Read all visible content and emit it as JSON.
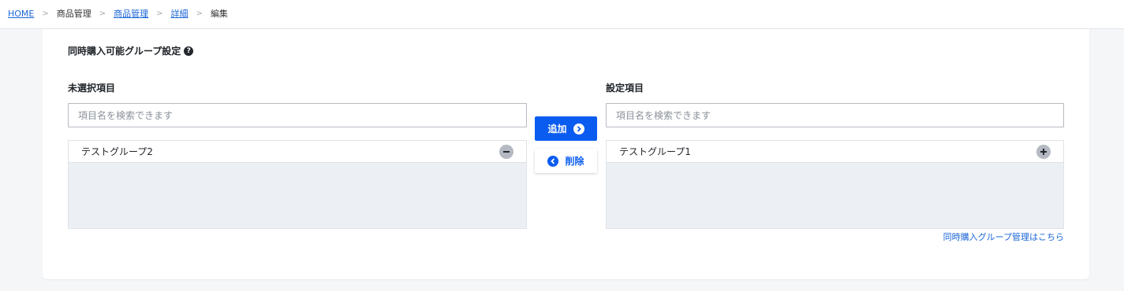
{
  "breadcrumb": {
    "items": [
      {
        "label": "HOME",
        "link": true
      },
      {
        "label": "商品管理",
        "link": false
      },
      {
        "label": "商品管理",
        "link": true
      },
      {
        "label": "詳細",
        "link": true
      },
      {
        "label": "編集",
        "link": false
      }
    ],
    "separator": ">"
  },
  "section": {
    "title": "同時購入可能グループ設定",
    "help_icon": "question-circle-icon"
  },
  "left_panel": {
    "label": "未選択項目",
    "search_placeholder": "項目名を検索できます",
    "items": [
      {
        "label": "テストグループ2",
        "icon": "minus-circle-icon"
      }
    ]
  },
  "right_panel": {
    "label": "設定項目",
    "search_placeholder": "項目名を検索できます",
    "items": [
      {
        "label": "テストグループ1",
        "icon": "plus-circle-icon"
      }
    ]
  },
  "actions": {
    "add_label": "追加",
    "remove_label": "削除"
  },
  "footer_link": "同時購入グループ管理はこちら",
  "colors": {
    "primary": "#0a5cf0",
    "link": "#1a66d6",
    "list_bg": "#eceff3"
  }
}
